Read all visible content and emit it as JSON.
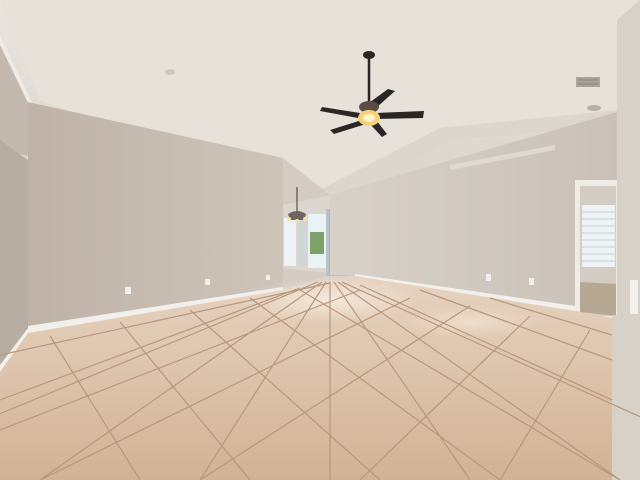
{
  "scene": {
    "kind": "photo",
    "subject": "empty-room-interior",
    "palette": {
      "ceiling": "#e7e2da",
      "ceiling_shadow": "#d6d0c6",
      "wall_left": "#c9bfb5",
      "wall_left_shadow": "#b9aea3",
      "wall_right": "#d0c8bf",
      "wall_right_light": "#ddd6ce",
      "baseboard": "#f2f0ec",
      "tile": "#d8b99d",
      "tile_grout": "#b8977d",
      "tile_glare": "#f0e0cc",
      "fan_body": "#2a2624",
      "fan_light": "#f5d27a",
      "window_light": "#e9f3f5",
      "blinds": "#e8eef2"
    },
    "icons": [
      "ceiling-fan-icon",
      "chandelier-icon",
      "outlet-icon",
      "vent-icon"
    ]
  }
}
